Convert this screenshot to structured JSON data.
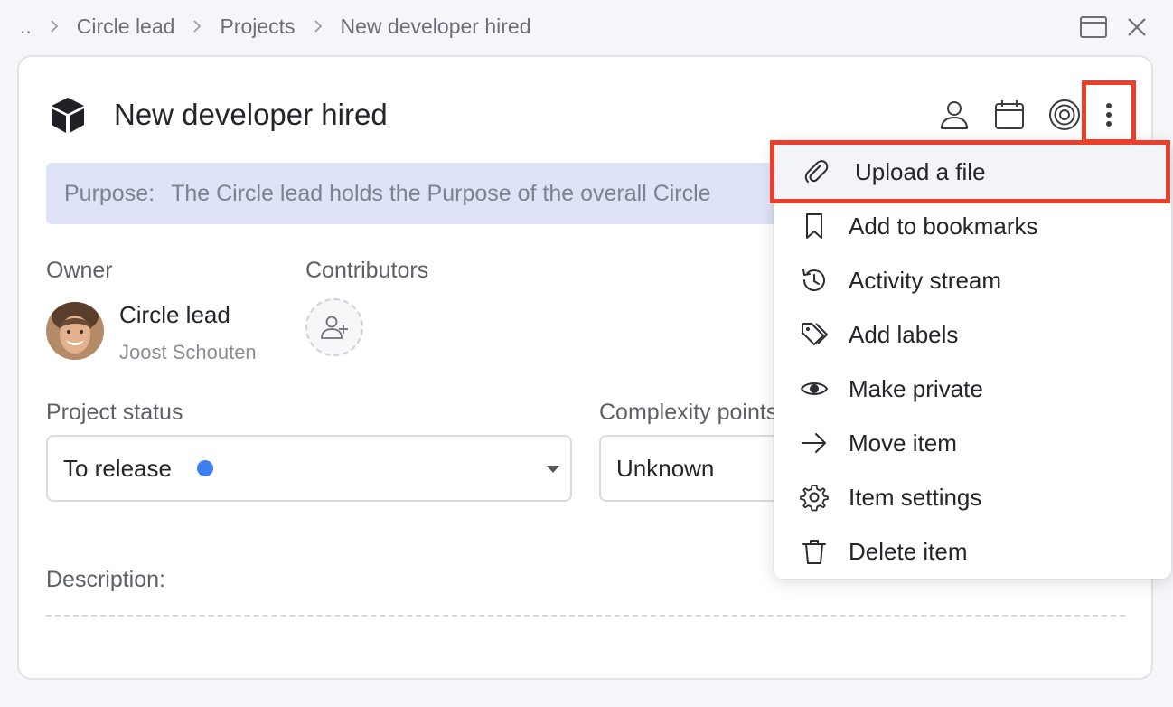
{
  "breadcrumb": {
    "root": "..",
    "items": [
      "Circle lead",
      "Projects",
      "New developer hired"
    ]
  },
  "item": {
    "title": "New developer hired",
    "purpose_label": "Purpose:",
    "purpose_text": "The Circle lead holds the Purpose of the overall Circle"
  },
  "owner": {
    "label": "Owner",
    "role": "Circle lead",
    "person": "Joost Schouten"
  },
  "contributors": {
    "label": "Contributors"
  },
  "project_status": {
    "label": "Project status",
    "value": "To release",
    "dot_color": "#3b7ff0"
  },
  "complexity": {
    "label": "Complexity points",
    "value": "Unknown"
  },
  "description": {
    "label": "Description:"
  },
  "menu": {
    "items": [
      {
        "label": "Upload a file",
        "icon": "paperclip-icon"
      },
      {
        "label": "Add to bookmarks",
        "icon": "bookmark-icon"
      },
      {
        "label": "Activity stream",
        "icon": "history-icon"
      },
      {
        "label": "Add labels",
        "icon": "tags-icon"
      },
      {
        "label": "Make private",
        "icon": "eye-icon"
      },
      {
        "label": "Move item",
        "icon": "arrow-right-icon"
      },
      {
        "label": "Item settings",
        "icon": "gear-icon"
      },
      {
        "label": "Delete item",
        "icon": "trash-icon"
      }
    ]
  },
  "colors": {
    "highlight": "#e8402c",
    "purpose_bg": "#dfe3f7"
  }
}
